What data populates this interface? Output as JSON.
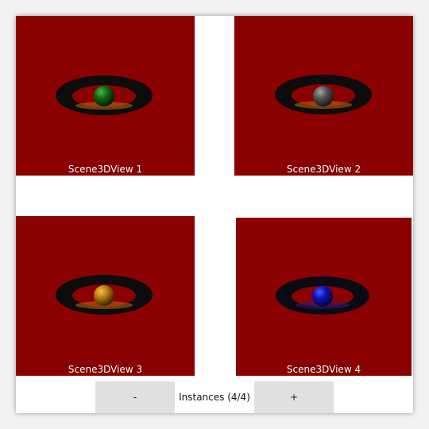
{
  "views": [
    {
      "label": "Scene3DView 1",
      "sphere_color": "green"
    },
    {
      "label": "Scene3DView 2",
      "sphere_color": "gray"
    },
    {
      "label": "Scene3DView 3",
      "sphere_color": "orange"
    },
    {
      "label": "Scene3DView 4",
      "sphere_color": "blue"
    }
  ],
  "toolbar": {
    "minus_label": "-",
    "instances_label": "Instances (4/4)",
    "plus_label": "+"
  },
  "colors": {
    "scene_background": "#8b0000",
    "window_background": "#ffffff",
    "button_background": "#e0e0e0"
  }
}
